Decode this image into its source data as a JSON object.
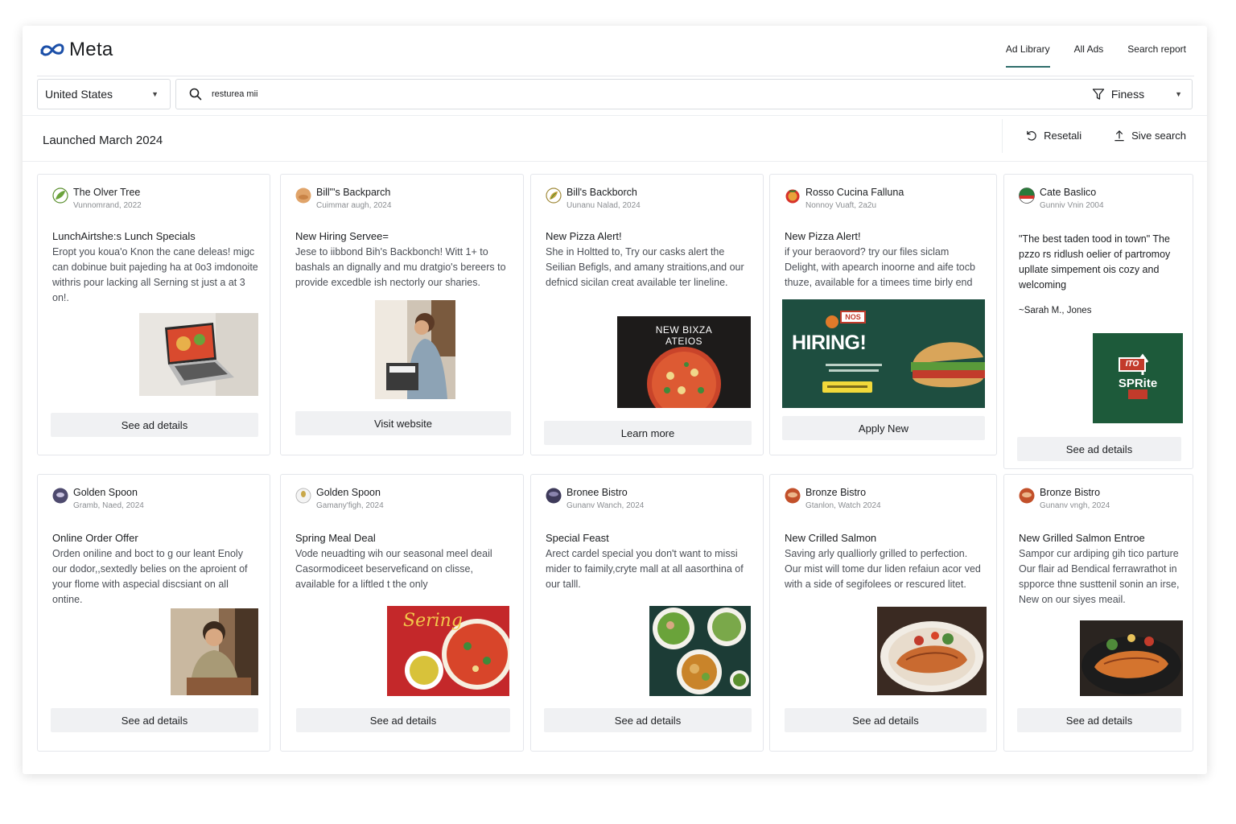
{
  "header": {
    "logo_text": "Meta",
    "nav": [
      {
        "label": "Ad Library",
        "active": true
      },
      {
        "label": "All Ads"
      },
      {
        "label": "Search report"
      }
    ]
  },
  "search": {
    "country": "United States",
    "query": "resturea mii",
    "filter_label": "Finess"
  },
  "toolbar": {
    "launched_label": "Launched March 2024",
    "reset_label": "Resetali",
    "save_label": "Sive search"
  },
  "colors": {
    "accent_underline": "#2e6d6a",
    "cta_background": "#f0f1f3",
    "border": "#e4e6eb"
  },
  "cards": [
    {
      "brand": "The Olver Tree",
      "meta": "Vunnomrand, 2022",
      "avatar_icon": "olive-leaf-icon",
      "title": "LunchAirtshe:s Lunch Specials",
      "body": "Eropt you koua'o Knon the cane deleas! migc can dobinue buit pajeding ha at 0o3 imdonoite withris pour lacking all Serning st just a at 3 on!.",
      "image": "laptop-food-photo",
      "cta": "See ad details"
    },
    {
      "brand": "Bill\"'s Backparch",
      "meta": "Cuimmar augh, 2024",
      "avatar_icon": "orange-circle-icon",
      "title": "New Hiring Servee=",
      "body": "Jese to iibbond Bih's Backbonch! Witt 1+ to bashals an dignally and mu dratgio's bereers to provide excedble ish nectorly our sharies.",
      "image": "worker-photo",
      "cta": "Visit website"
    },
    {
      "brand": "Bill's Backborch",
      "meta": "Uunanu Nalad, 2024",
      "avatar_icon": "leaf-icon",
      "title": "New Pizza Alert!",
      "body": "She in Holtted to, Try our casks alert the Seilian Befigls, and amany straitions,and our defnicd sicilan creat available ter lineline.",
      "image_text": "NEW BIXZA ATEIOS",
      "image": "pizza-ad",
      "cta": "Learn more"
    },
    {
      "brand": "Rosso Cucina Falluna",
      "meta": "Nonnoy Vuaft, 2a2u",
      "avatar_icon": "tomato-icon",
      "title": "New Pizza Alert!",
      "body": "if your beraovord? try our files siclam Delight, with apearch inoorne and aife tocb thuze, available for a timees time birly end",
      "image_text": "HIRING!",
      "image_badge": "NOS",
      "image": "hiring-sandwich-ad",
      "cta": "Apply New"
    },
    {
      "brand": "Cate Baslico",
      "meta": "Gunniv Vnin 2004",
      "avatar_icon": "italian-flag-icon",
      "quote": "\"The best taden tood in town\" The pzzo rs ridlush oelier of partromoy upllate simpement ois cozy and welcoming",
      "attribution": "~Sarah M., Jones",
      "image_text": "SPRite",
      "image_badge": "ITO",
      "image": "sprite-ad",
      "cta": "See ad details"
    },
    {
      "brand": "Golden Spoon",
      "meta": "Gramb, Naed, 2024",
      "avatar_icon": "purple-circle-icon",
      "title": "Online Order Offer",
      "body": "Orden oniline and boct to g our leant Enoly our dodor,,sextedly belies on the aproient of your flome with aspecial discsiant on all ontine.",
      "image": "woman-photo",
      "cta": "See ad details"
    },
    {
      "brand": "Golden Spoon",
      "meta": "Gamany'figh, 2024",
      "avatar_icon": "spoon-icon",
      "title": "Spring Meal Deal",
      "body": "Vode neuadting wih our seasonal meel deail Casormodiceet beserveficand on clisse, available for a liftled t the only",
      "image_text": "Sering",
      "image": "spring-meal-ad",
      "cta": "See ad details"
    },
    {
      "brand": "Bronee Bistro",
      "meta": "Gunanv Wanch, 2024",
      "avatar_icon": "dark-purple-circle-icon",
      "title": "Special Feast",
      "body": "Arect cardel special you don't want to missi mider to faimily,cryte mall at all aasorthina of our talll.",
      "image": "salad-bowls-photo",
      "cta": "See ad details"
    },
    {
      "brand": "Bronze Bistro",
      "meta": "Gtanlon, Watch 2024",
      "avatar_icon": "bronze-circle-icon",
      "title": "New Crilled Salmon",
      "body": "Saving arly qualliorly grilled to perfection. Our mist will tome dur liden refaiun acor ved with a side of segifolees or rescured litet.",
      "image": "salmon-photo",
      "cta": "See ad details"
    },
    {
      "brand": "Bronze Bistro",
      "meta": "Gunanv vngh, 2024",
      "avatar_icon": "bronze-circle-icon",
      "title": "New Grilled Salmon Entroe",
      "body": "Sampor cur ardiping gih tico parture Our flair ad Bendical ferrawrathot in spporce thne susttenil sonin an irse, New on our siyes meail.",
      "image": "salmon-plate-photo",
      "cta": "See ad details"
    }
  ]
}
